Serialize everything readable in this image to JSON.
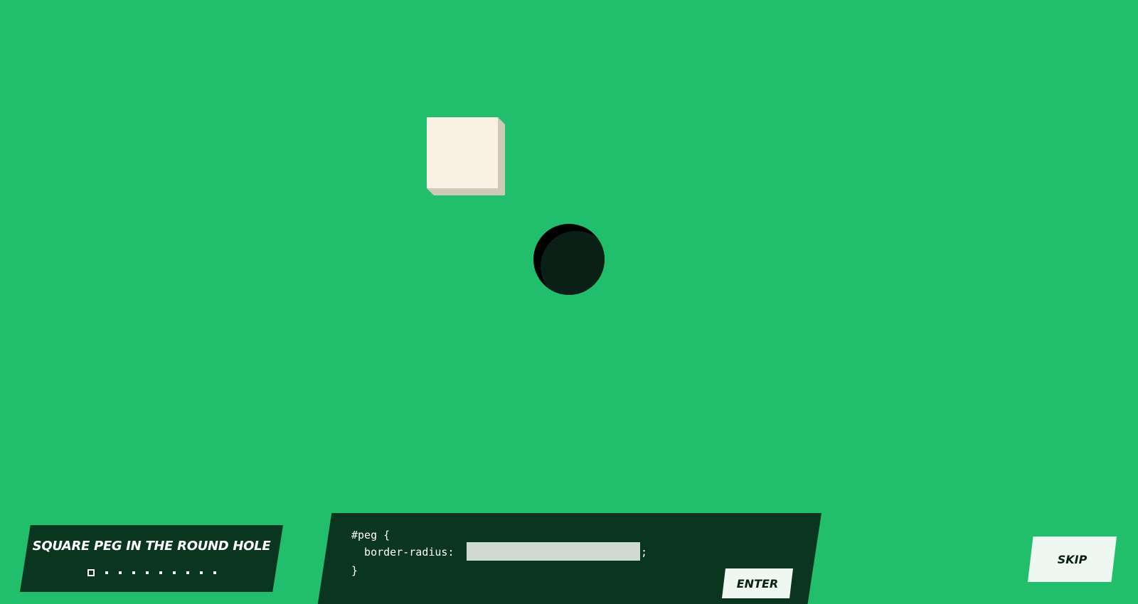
{
  "game": {
    "title": "SQUARE PEG IN THE ROUND HOLE",
    "level_indicator": {
      "current": 1,
      "total": 10
    }
  },
  "code": {
    "selector_line": "#peg {",
    "property_line": "  border-radius: ",
    "input_value": "",
    "semicolon": ";",
    "closing_brace": "}"
  },
  "buttons": {
    "enter_label": "ENTER",
    "skip_label": "SKIP"
  },
  "colors": {
    "background": "#21bf6b",
    "panel": "#0a3620",
    "peg": "#f8f1e4",
    "hole": "#0a1f15",
    "button": "#eef7f1"
  }
}
